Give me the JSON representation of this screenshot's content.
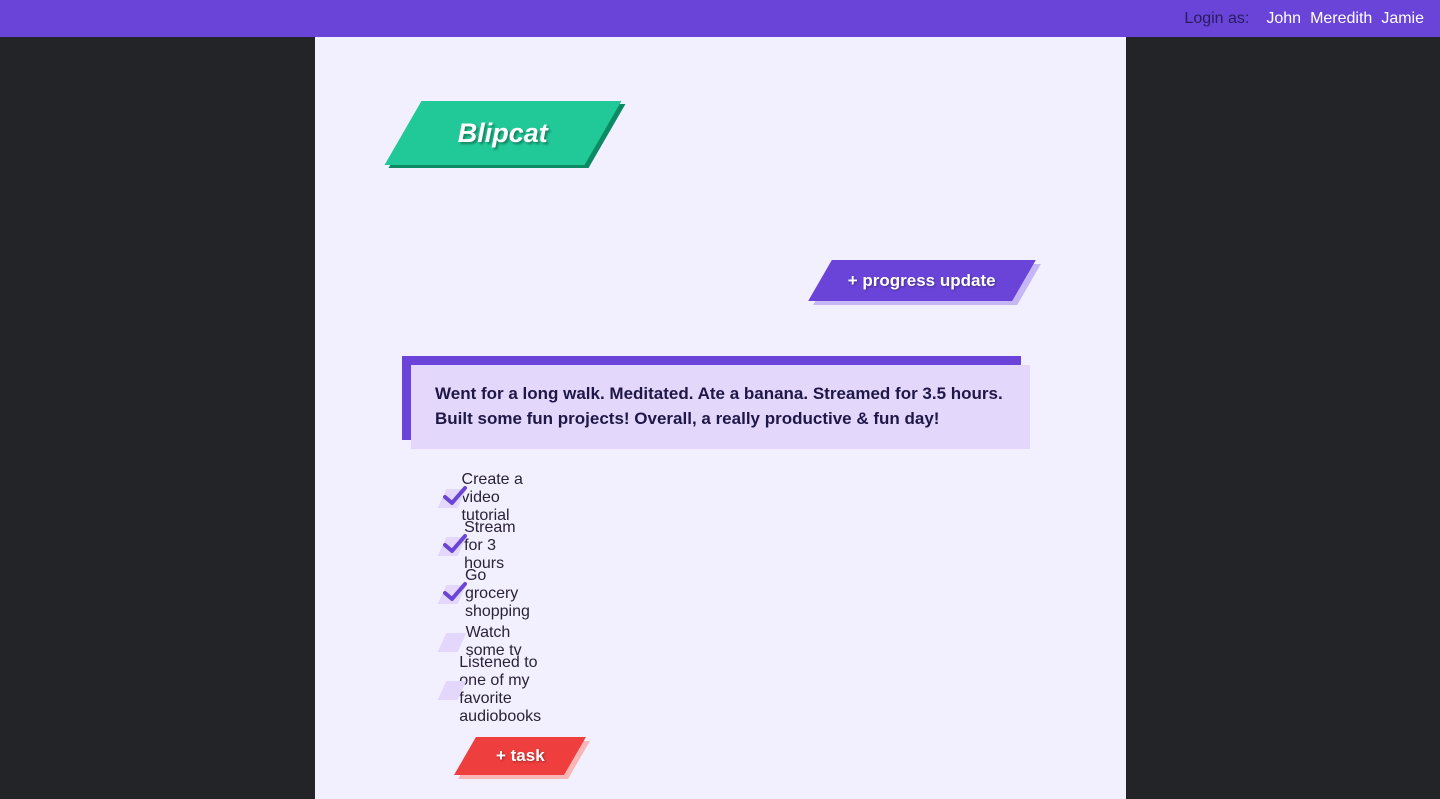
{
  "topbar": {
    "login_label": "Login as:",
    "users": [
      "John",
      "Meredith",
      "Jamie"
    ]
  },
  "logo": {
    "text": "Blipcat"
  },
  "actions": {
    "progress_update_label": "+ progress update",
    "add_task_label": "+ task"
  },
  "progress_note": {
    "text": "Went for a long walk. Meditated. Ate a banana. Streamed for 3.5 hours. Built some fun projects! Overall, a really productive & fun day!"
  },
  "tasks": [
    {
      "label": "Create a video tutorial",
      "done": true
    },
    {
      "label": "Stream for 3 hours",
      "done": true
    },
    {
      "label": "Go grocery shopping",
      "done": true
    },
    {
      "label": "Watch some tv",
      "done": false
    },
    {
      "label": "Listened to one of my favorite audiobooks",
      "done": false
    }
  ],
  "colors": {
    "topbar": "#6a44d8",
    "panel": "#f2f0fe",
    "logo": "#20c997",
    "primary": "#6a44d8",
    "danger": "#ef3e3e",
    "note_bg": "#e3d8fc"
  }
}
